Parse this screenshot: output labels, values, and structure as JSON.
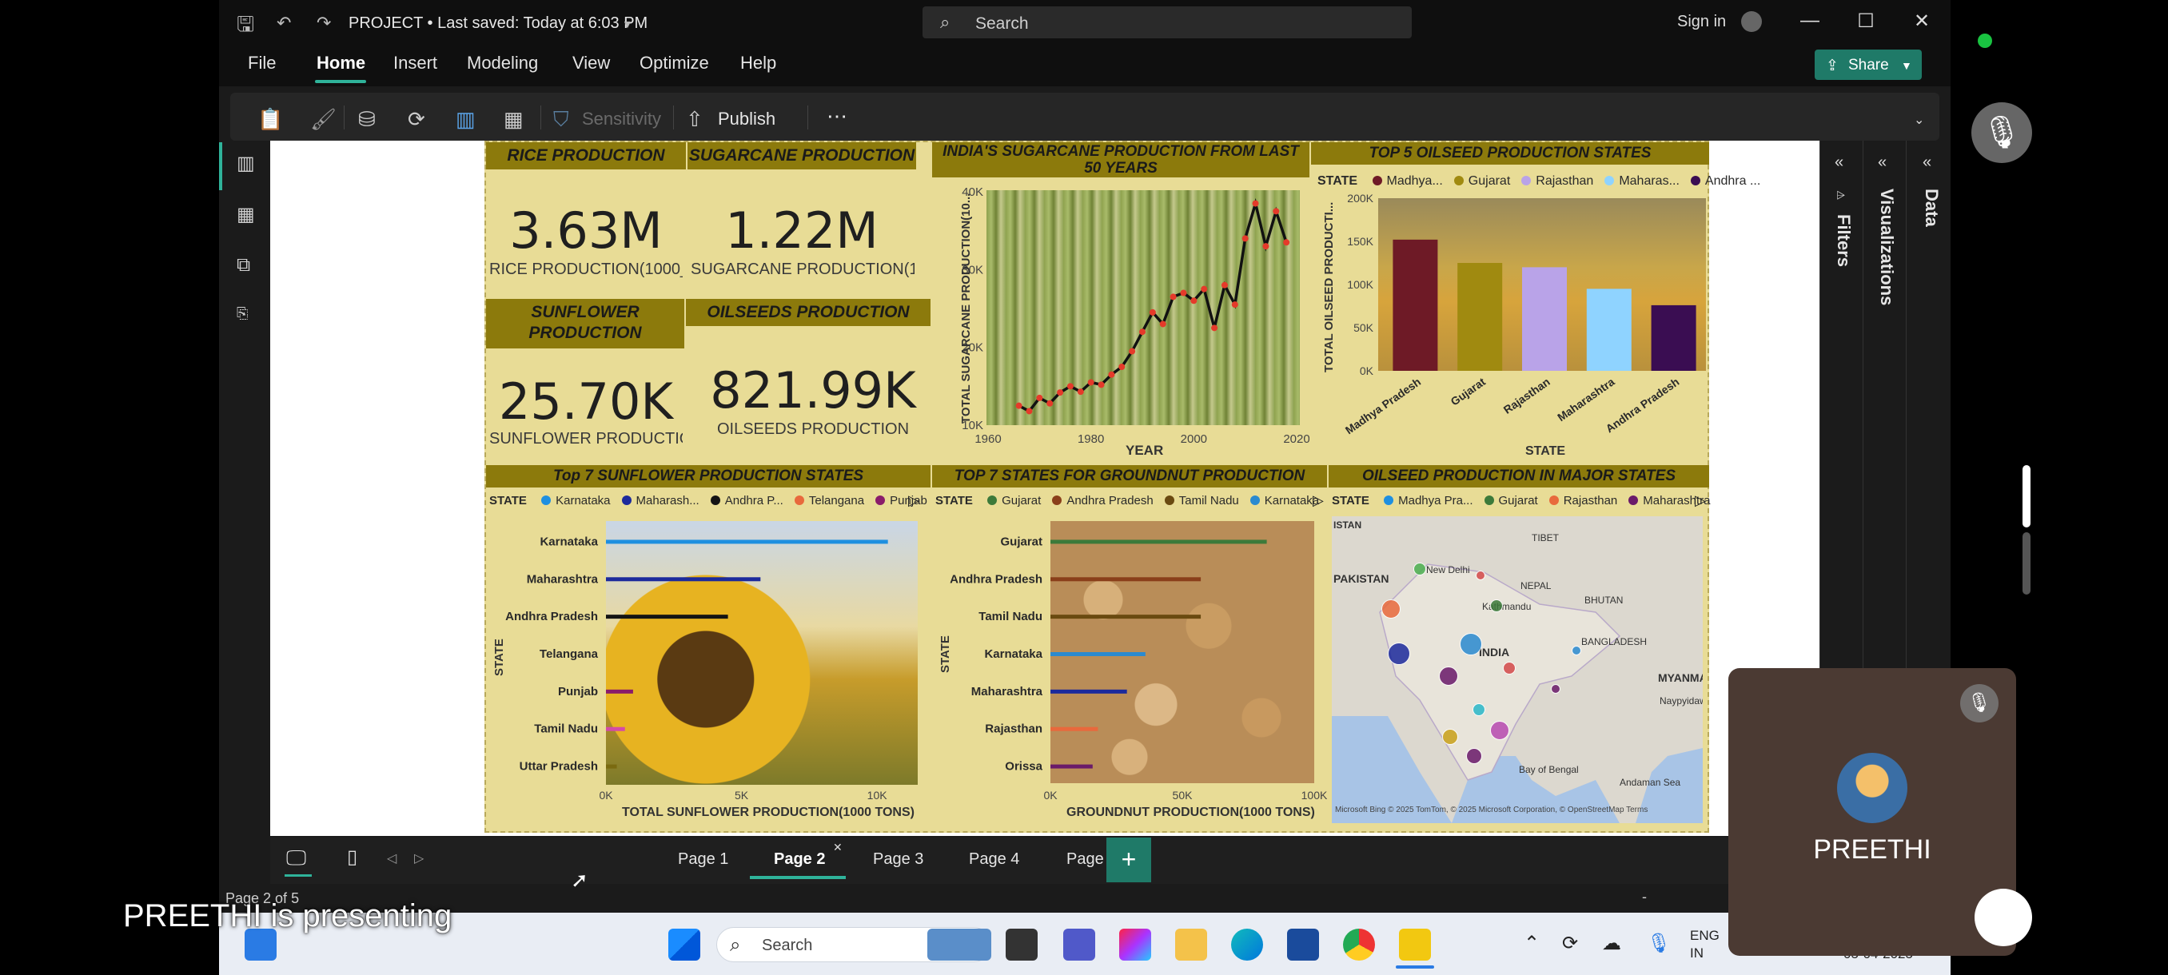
{
  "window": {
    "title": "PROJECT • Last saved: Today at 6:03 PM",
    "search_label": "Search",
    "sign_in": "Sign in",
    "share": "Share"
  },
  "menu": [
    "File",
    "Home",
    "Insert",
    "Modeling",
    "View",
    "Optimize",
    "Help"
  ],
  "ribbon": {
    "sensitivity": "Sensitivity",
    "publish": "Publish",
    "more": "⋯"
  },
  "kpis": {
    "rice_title": "RICE PRODUCTION",
    "rice_value": "3.63M",
    "rice_sub": "RICE PRODUCTION(1000_...",
    "sugar_title": "SUGARCANE PRODUCTION",
    "sugar_value": "1.22M",
    "sugar_sub": "SUGARCANE PRODUCTION(1000 ...",
    "sunflower_title": "SUNFLOWER PRODUCTION",
    "sunflower_value": "25.70K",
    "sunflower_sub": "SUNFLOWER PRODUCTIO...",
    "oilseeds_title": "OILSEEDS PRODUCTION",
    "oilseeds_value": "821.99K",
    "oilseeds_sub": "OILSEEDS PRODUCTION"
  },
  "line_chart": {
    "title": "INDIA'S SUGARCANE PRODUCTION FROM LAST 50 YEARS",
    "xlabel": "YEAR",
    "ylabel": "TOTAL SUGARCANE PRODUCTION(10...",
    "xticks": [
      "1960",
      "1980",
      "2000",
      "2020"
    ],
    "yticks": [
      "40K",
      "30K",
      "20K",
      "10K"
    ]
  },
  "oilseed_chart": {
    "title": "TOP 5 OILSEED PRODUCTION STATES",
    "legend_title": "STATE",
    "legend": [
      "Madhya...",
      "Gujarat",
      "Rajasthan",
      "Maharas...",
      "Andhra ..."
    ],
    "xlabel": "STATE",
    "ylabel": "TOTAL OILSEED PRODUCTI...",
    "yticks": [
      "200K",
      "150K",
      "100K",
      "50K",
      "0K"
    ],
    "categories": [
      "Madhya Pradesh",
      "Gujarat",
      "Rajasthan",
      "Maharashtra",
      "Andhra Pradesh"
    ]
  },
  "sunflower_chart": {
    "title": "Top 7 SUNFLOWER PRODUCTION STATES",
    "legend_title": "STATE",
    "legend": [
      "Karnataka",
      "Maharash...",
      "Andhra P...",
      "Telangana",
      "Punjab"
    ],
    "categories": [
      "Karnataka",
      "Maharashtra",
      "Andhra Pradesh",
      "Telangana",
      "Punjab",
      "Tamil Nadu",
      "Uttar Pradesh"
    ],
    "xlabel": "TOTAL SUNFLOWER PRODUCTION(1000 TONS)",
    "ylabel": "STATE",
    "xticks": [
      "0K",
      "5K",
      "10K"
    ]
  },
  "groundnut_chart": {
    "title": "TOP 7 STATES FOR GROUNDNUT PRODUCTION",
    "legend_title": "STATE",
    "legend": [
      "Gujarat",
      "Andhra Pradesh",
      "Tamil Nadu",
      "Karnataka"
    ],
    "categories": [
      "Gujarat",
      "Andhra Pradesh",
      "Tamil Nadu",
      "Karnataka",
      "Maharashtra",
      "Rajasthan",
      "Orissa"
    ],
    "xlabel": "GROUNDNUT PRODUCTION(1000 TONS)",
    "ylabel": "STATE",
    "xticks": [
      "0K",
      "50K",
      "100K"
    ]
  },
  "map_chart": {
    "title": "OILSEED PRODUCTION IN MAJOR STATES",
    "legend_title": "STATE",
    "legend": [
      "Madhya Pra...",
      "Gujarat",
      "Rajasthan",
      "Maharashtra"
    ],
    "labels": [
      "ISTAN",
      "PAKISTAN",
      "New Delhi",
      "NEPAL",
      "Kathmandu",
      "TIBET",
      "BHUTAN",
      "BANGLADESH",
      "INDIA",
      "MYANMAR",
      "Naypyidaw",
      "Bay of Bengal",
      "Andaman Sea"
    ],
    "attribution": "Microsoft Bing   © 2025 TomTom, © 2025 Microsoft Corporation, © OpenStreetMap  Terms"
  },
  "panes": {
    "filters": "Filters",
    "visualizations": "Visualizations",
    "data": "Data"
  },
  "pages": {
    "tabs": [
      "Page 1",
      "Page 2",
      "Page 3",
      "Page 4",
      "Page 5"
    ],
    "active": "Page 2",
    "status": "Page 2 of 5"
  },
  "taskbar": {
    "search": "Search",
    "lang1": "ENG",
    "lang2": "IN",
    "date": "05-04-2025"
  },
  "overlay": {
    "presenting": "PREETHI is presenting",
    "participant": "PREETHI"
  },
  "colors": {
    "accent": "#2fb39a",
    "band": "#8c7a0c",
    "report_bg": "#e8dc96"
  },
  "chart_data": [
    {
      "type": "line",
      "title": "INDIA'S SUGARCANE PRODUCTION FROM LAST 50 YEARS",
      "xlabel": "YEAR",
      "ylabel": "TOTAL SUGARCANE PRODUCTION(10...",
      "xlim": [
        1960,
        2020
      ],
      "ylim": [
        10000,
        40000
      ],
      "x": [
        1966,
        1968,
        1970,
        1972,
        1974,
        1976,
        1978,
        1980,
        1982,
        1984,
        1986,
        1988,
        1990,
        1992,
        1994,
        1996,
        1998,
        2000,
        2002,
        2004,
        2006,
        2008,
        2010,
        2012,
        2014,
        2016,
        2018
      ],
      "y": [
        12500,
        11800,
        13500,
        12800,
        14200,
        15000,
        14300,
        15500,
        15200,
        16500,
        17500,
        19500,
        22000,
        24500,
        23000,
        26500,
        27000,
        26000,
        27500,
        22500,
        28000,
        25500,
        34000,
        38500,
        33000,
        37500,
        33500
      ]
    },
    {
      "type": "bar",
      "title": "TOP 5 OILSEED PRODUCTION STATES",
      "xlabel": "STATE",
      "ylabel": "TOTAL OILSEED PRODUCTI...",
      "ylim": [
        0,
        200000
      ],
      "categories": [
        "Madhya Pradesh",
        "Gujarat",
        "Rajasthan",
        "Maharashtra",
        "Andhra Pradesh"
      ],
      "values": [
        152000,
        125000,
        120000,
        95000,
        76000
      ],
      "colors": [
        "#6e1a26",
        "#a08a10",
        "#b9a3e8",
        "#8fd3ff",
        "#3a0d52"
      ]
    },
    {
      "type": "bar",
      "orientation": "horizontal",
      "title": "Top 7 SUNFLOWER PRODUCTION STATES",
      "xlabel": "TOTAL SUNFLOWER PRODUCTION(1000 TONS)",
      "ylabel": "STATE",
      "xlim": [
        0,
        11500
      ],
      "categories": [
        "Karnataka",
        "Maharashtra",
        "Andhra Pradesh",
        "Telangana",
        "Punjab",
        "Tamil Nadu",
        "Uttar Pradesh"
      ],
      "values": [
        10400,
        5700,
        4500,
        0,
        1000,
        700,
        400
      ],
      "colors": [
        "#1e8fe0",
        "#1c2a9c",
        "#141414",
        "#e8693c",
        "#8a1c6a",
        "#d44aa8",
        "#7a6a10"
      ]
    },
    {
      "type": "bar",
      "orientation": "horizontal",
      "title": "TOP 7 STATES FOR GROUNDNUT PRODUCTION",
      "xlabel": "GROUNDNUT PRODUCTION(1000 TONS)",
      "ylabel": "STATE",
      "xlim": [
        0,
        100000
      ],
      "categories": [
        "Gujarat",
        "Andhra Pradesh",
        "Tamil Nadu",
        "Karnataka",
        "Maharashtra",
        "Rajasthan",
        "Orissa"
      ],
      "values": [
        82000,
        57000,
        57000,
        36000,
        29000,
        18000,
        16000
      ],
      "colors": [
        "#3c7a3a",
        "#8a3f1a",
        "#6a4a10",
        "#2a8ad0",
        "#1c2a9c",
        "#e8693c",
        "#6a1a6a"
      ]
    }
  ]
}
